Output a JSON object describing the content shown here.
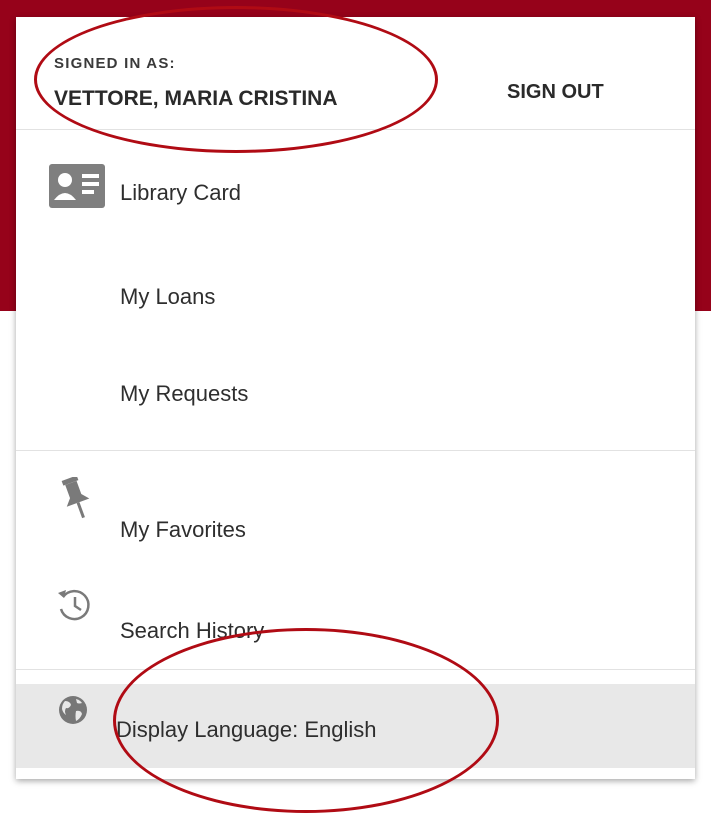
{
  "header": {
    "signed_in_label": "SIGNED IN AS:",
    "user_name": "VETTORE, MARIA CRISTINA",
    "sign_out_label": "SIGN OUT"
  },
  "menu": {
    "library_card": {
      "label": "Library Card",
      "icon": "id-card-icon"
    },
    "my_loans": {
      "label": "My Loans"
    },
    "my_requests": {
      "label": "My Requests"
    },
    "my_favorites": {
      "label": "My Favorites",
      "icon": "pin-icon"
    },
    "search_history": {
      "label": "Search History",
      "icon": "history-icon"
    },
    "display_language": {
      "label": "Display Language: English",
      "icon": "globe-icon"
    }
  },
  "colors": {
    "brand": "#96021a",
    "highlight_ellipse": "#b00b14",
    "selected_row_bg": "#e8e8e8"
  }
}
